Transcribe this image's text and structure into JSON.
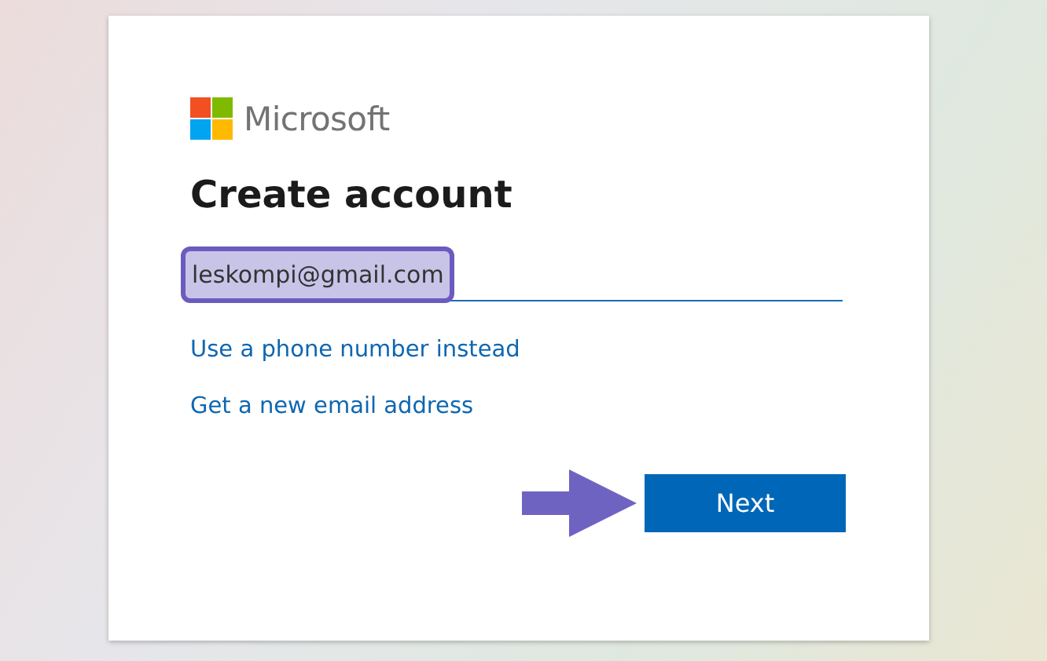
{
  "logo": {
    "text": "Microsoft"
  },
  "title": "Create account",
  "email_field": {
    "value": "leskompi@gmail.com",
    "highlighted": true
  },
  "links": [
    "Use a phone number instead",
    "Get a new email address"
  ],
  "next_button": {
    "label": "Next",
    "pointed_at": true
  }
}
